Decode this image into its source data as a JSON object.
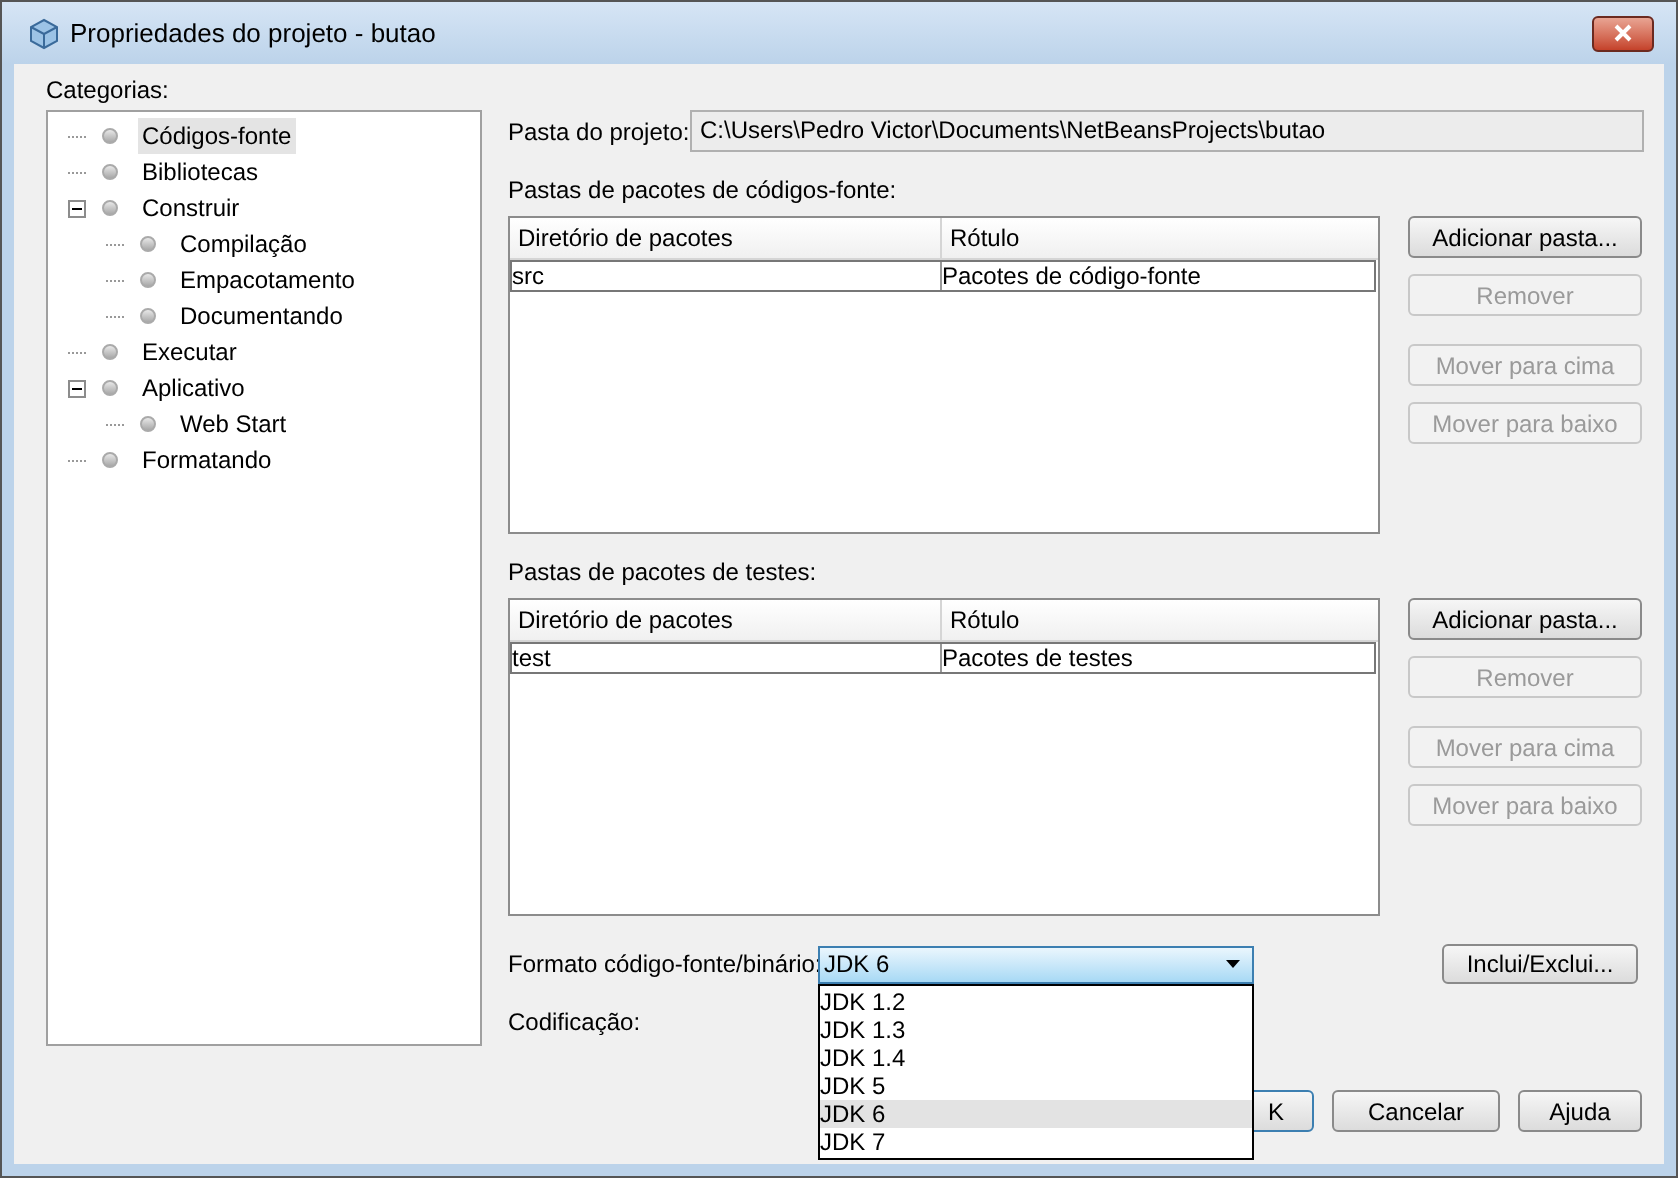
{
  "window": {
    "title": "Propriedades do projeto - butao"
  },
  "categories": {
    "label": "Categorias:",
    "items": [
      {
        "label": "Códigos-fonte",
        "selected": true
      },
      {
        "label": "Bibliotecas",
        "selected": false
      },
      {
        "label": "Construir",
        "selected": false,
        "expanded": true,
        "children": [
          {
            "label": "Compilação",
            "selected": false
          },
          {
            "label": "Empacotamento",
            "selected": false
          },
          {
            "label": "Documentando",
            "selected": false
          }
        ]
      },
      {
        "label": "Executar",
        "selected": false
      },
      {
        "label": "Aplicativo",
        "selected": false,
        "expanded": true,
        "children": [
          {
            "label": "Web Start",
            "selected": false
          }
        ]
      },
      {
        "label": "Formatando",
        "selected": false
      }
    ]
  },
  "project_folder": {
    "label": "Pasta do projeto:",
    "value": "C:\\Users\\Pedro Victor\\Documents\\NetBeansProjects\\butao"
  },
  "source_packages": {
    "label": "Pastas de pacotes de códigos-fonte:",
    "columns": [
      "Diretório de pacotes",
      "Rótulo"
    ],
    "rows": [
      {
        "cells": [
          "src",
          "Pacotes de código-fonte"
        ]
      }
    ],
    "buttons": [
      {
        "label": "Adicionar pasta...",
        "disabled": false
      },
      {
        "label": "Remover",
        "disabled": true
      },
      {
        "label": "Mover para cima",
        "disabled": true
      },
      {
        "label": "Mover para baixo",
        "disabled": true
      }
    ]
  },
  "test_packages": {
    "label": "Pastas de pacotes de testes:",
    "columns": [
      "Diretório de pacotes",
      "Rótulo"
    ],
    "rows": [
      {
        "cells": [
          "test",
          "Pacotes de testes"
        ]
      }
    ],
    "buttons": [
      {
        "label": "Adicionar pasta...",
        "disabled": false
      },
      {
        "label": "Remover",
        "disabled": true
      },
      {
        "label": "Mover para cima",
        "disabled": true
      },
      {
        "label": "Mover para baixo",
        "disabled": true
      }
    ]
  },
  "format": {
    "label": "Formato código-fonte/binário:",
    "value": "JDK 6",
    "expanded": true,
    "options": [
      {
        "label": "JDK 1.2",
        "selected": false
      },
      {
        "label": "JDK 1.3",
        "selected": false
      },
      {
        "label": "JDK 1.4",
        "selected": false
      },
      {
        "label": "JDK 5",
        "selected": false
      },
      {
        "label": "JDK 6",
        "selected": true
      },
      {
        "label": "JDK 7",
        "selected": false
      }
    ]
  },
  "include_exclude_button": "Inclui/Exclui...",
  "encoding": {
    "label": "Codificação:"
  },
  "footer_buttons": [
    {
      "label": "K",
      "kind": "covered"
    },
    {
      "label": "Cancelar",
      "kind": "normal"
    },
    {
      "label": "Ajuda",
      "kind": "normal"
    }
  ]
}
